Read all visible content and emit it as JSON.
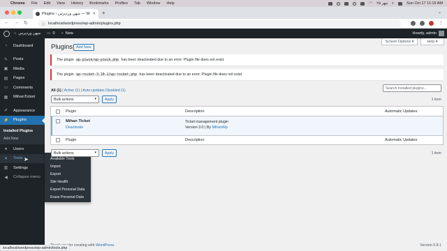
{
  "macos": {
    "menus": [
      "Chrome",
      "File",
      "Edit",
      "View",
      "History",
      "Bookmarks",
      "Profiles",
      "Tab",
      "Window",
      "Help"
    ],
    "clock": "Sun Oct 17  11:19 AM",
    "date_rtl": "۲۵ مهر"
  },
  "browser": {
    "tab_title": "Plugins ‹ میهن وردپرس — WordP",
    "url": "localhost/wordpress/wp-admin/plugins.php",
    "status_url": "localhost/wordpress/wp-admin/tools.php"
  },
  "adminbar": {
    "site_name": "میهن وردپرس",
    "comments_count": "0",
    "new_label": "New",
    "howdy": "Howdy, admin"
  },
  "sidebar": {
    "items": [
      {
        "label": "Dashboard",
        "icon": "gauge-icon"
      },
      {
        "label": "Posts",
        "icon": "pin-icon"
      },
      {
        "label": "Media",
        "icon": "media-icon"
      },
      {
        "label": "Pages",
        "icon": "page-icon"
      },
      {
        "label": "Comments",
        "icon": "comment-icon"
      },
      {
        "label": "MihanTicket",
        "icon": "ticket-icon"
      },
      {
        "label": "Appearance",
        "icon": "brush-icon"
      },
      {
        "label": "Plugins",
        "icon": "plug-icon"
      },
      {
        "label": "Users",
        "icon": "user-icon"
      },
      {
        "label": "Tools",
        "icon": "wrench-icon"
      },
      {
        "label": "Settings",
        "icon": "settings-icon"
      },
      {
        "label": "Collapse menu",
        "icon": "collapse-icon"
      }
    ],
    "plugins_sub": [
      "Installed Plugins",
      "Add New"
    ]
  },
  "tools_flyout": [
    "Available Tools",
    "Import",
    "Export",
    "Site Health",
    "Export Personal Data",
    "Erase Personal Data"
  ],
  "header": {
    "screen_options": "Screen Options ▾",
    "help": "Help ▾",
    "title": "Plugins",
    "add_new": "Add New"
  },
  "notices": [
    {
      "pre": "The plugin",
      "code": "wp-piwik/wp-piwik.php",
      "post": "has been deactivated due to an error: Plugin file does not exist."
    },
    {
      "pre": "The plugin",
      "code": "wp-rocket-3.10.1/wp-rocket.php",
      "post": "has been deactivated due to an error: Plugin file does not exist."
    }
  ],
  "filters": {
    "all": "All (1)",
    "sep1": " | ",
    "active": "Active (1)",
    "sep2": " | ",
    "auto": "Auto-updates Disabled (1)"
  },
  "search": {
    "placeholder": "Search installed plugins..."
  },
  "bulk": {
    "label": "Bulk actions",
    "apply": "Apply",
    "count": "1 item"
  },
  "table": {
    "headers": {
      "plugin": "Plugin",
      "description": "Description",
      "updates": "Automatic Updates"
    },
    "row": {
      "name": "Mihan Ticket",
      "action": "Deactivate",
      "description": "Ticket management plugin",
      "version": "Version 3.0 | By ",
      "author": "MihanWp"
    }
  },
  "footer": {
    "thanks": "Thank you for creating with ",
    "wp_link": "WordPress",
    "period": ".",
    "version": "Version 5.8.1"
  },
  "colors": {
    "accent": "#2271b1",
    "sidebar": "#1d2327",
    "error": "#d63638"
  }
}
